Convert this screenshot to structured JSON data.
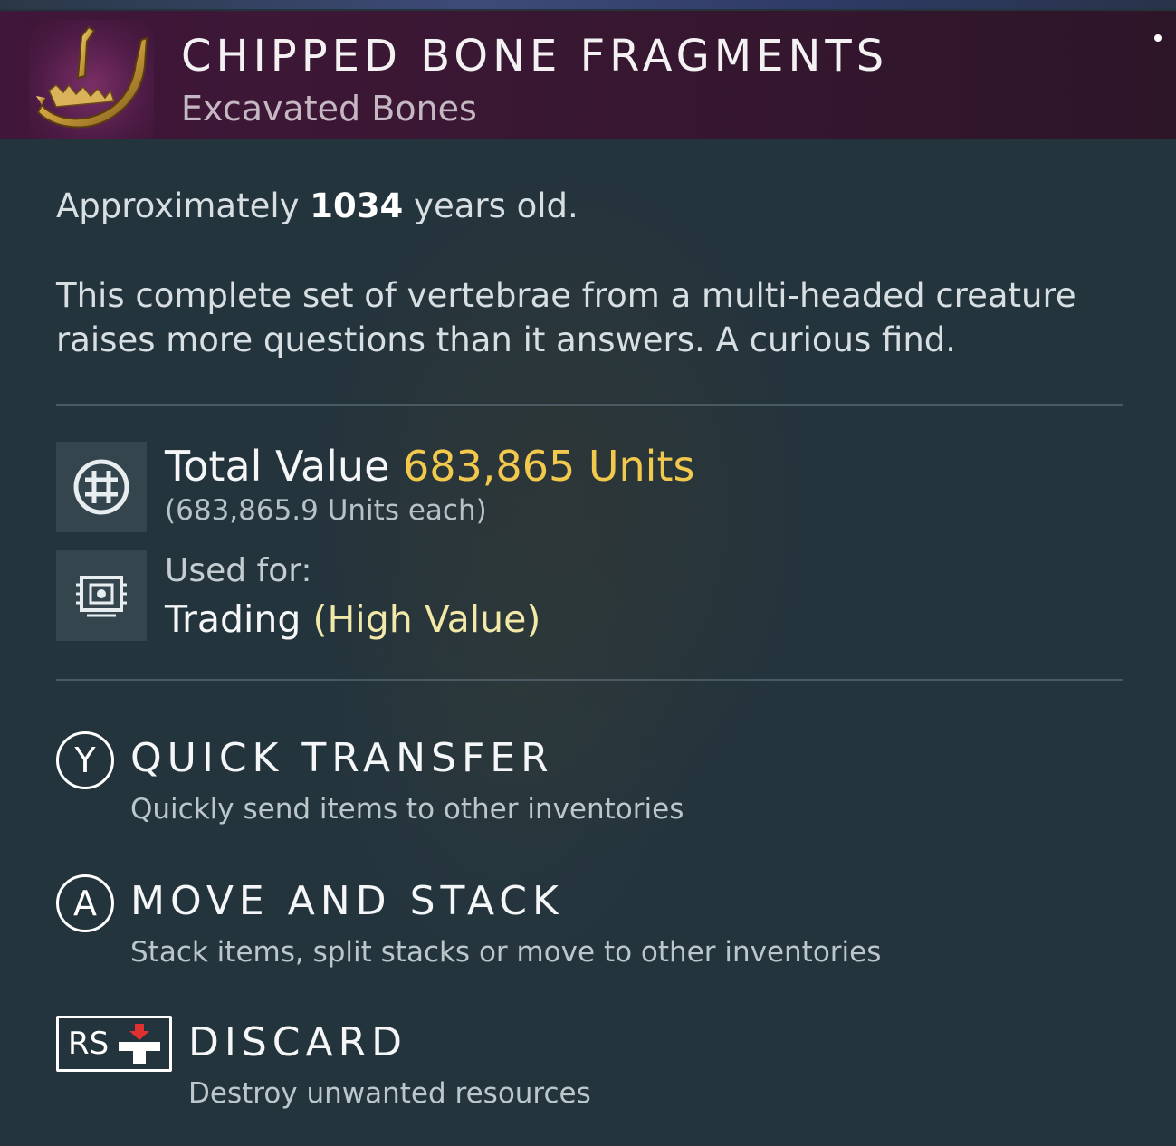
{
  "item": {
    "name": "CHIPPED BONE FRAGMENTS",
    "category": "Excavated Bones",
    "icon": "bone-jaw-icon"
  },
  "description": {
    "age_prefix": "Approximately",
    "age_value": "1034",
    "age_suffix": "years old.",
    "text": "This complete set of vertebrae from a multi-headed creature raises more questions than it answers. A curious find."
  },
  "value": {
    "icon": "units-currency-icon",
    "label": "Total Value",
    "amount": "683,865 Units",
    "each": "(683,865.9 Units each)"
  },
  "usage": {
    "icon": "trade-chip-icon",
    "label": "Used for:",
    "value": "Trading",
    "qualifier": "(High Value)"
  },
  "actions": [
    {
      "button": "Y",
      "title": "QUICK TRANSFER",
      "desc": "Quickly send items to other inventories"
    },
    {
      "button": "A",
      "title": "MOVE AND STACK",
      "desc": "Stack items, split stacks or move to other inventories"
    },
    {
      "button": "RS",
      "title": "DISCARD",
      "desc": "Destroy unwanted resources"
    }
  ],
  "colors": {
    "header_bg": "#3b1830",
    "panel_bg": "#24343d",
    "units_accent": "#f2c94c",
    "high_value_accent": "#f2e8a8"
  }
}
